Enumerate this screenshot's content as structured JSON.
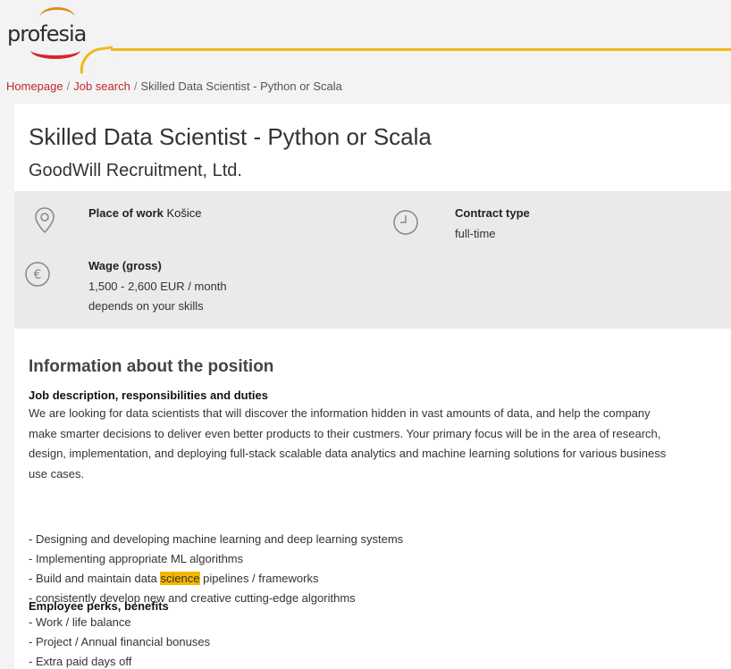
{
  "header": {
    "logo_text": "profesia",
    "colors": {
      "accent_yellow": "#f0b91d",
      "logo_red": "#d9222a",
      "logo_orange": "#e08a1e",
      "link_red": "#c0272d"
    }
  },
  "breadcrumb": {
    "home": "Homepage",
    "sep1": "/",
    "job_search": "Job search",
    "sep2": "/",
    "current": "Skilled Data Scientist - Python or Scala"
  },
  "job": {
    "title": "Skilled Data Scientist - Python or Scala",
    "company": "GoodWill Recruitment, Ltd."
  },
  "info": {
    "place_label": "Place of work",
    "place_value": "Košice",
    "contract_label": "Contract type",
    "contract_value": "full-time",
    "wage_label": "Wage (gross)",
    "wage_value": "1,500 - 2,600 EUR / month",
    "wage_note": "depends on your skills",
    "icons": [
      "location-pin-icon",
      "clock-icon",
      "euro-icon"
    ]
  },
  "position": {
    "section_title": "Information about the position",
    "desc_heading": "Job description, responsibilities and duties",
    "desc_lines": [
      "We are looking for data scientists that will discover the information hidden in vast amounts of data, and help the company",
      "make smarter decisions to deliver even better products to their custmers. Your primary focus will be in the area of research,",
      "design, implementation, and deploying full-stack scalable data analytics and machine learning solutions for various business",
      "use cases."
    ],
    "duties": {
      "item1": "- Designing and developing machine learning and deep learning systems",
      "item2": "- Implementing appropriate ML algorithms",
      "item3_before": "- Build and maintain data ",
      "item3_highlight": "science",
      "item3_after": " pipelines / frameworks",
      "item4": "- consistently develop new and creative cutting-edge algorithms"
    },
    "perks_heading": "Employee perks, benefits",
    "perks": [
      "- Work / life balance",
      "- Project / Annual financial bonuses",
      "- Extra paid days off"
    ]
  }
}
